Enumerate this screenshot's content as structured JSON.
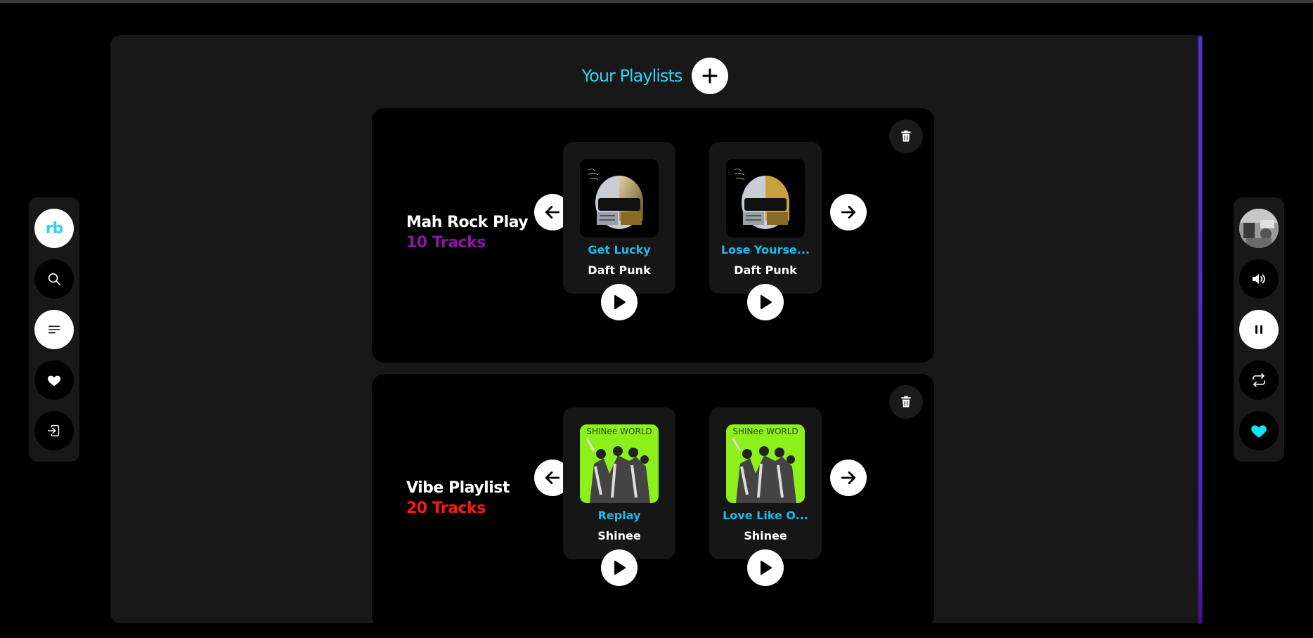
{
  "header": {
    "title": "Your Playlists"
  },
  "app": {
    "logo_text": "rb"
  },
  "colors": {
    "accent": "#2fd3f1",
    "track_title": "#1ebbe8",
    "count_purple": "#8b16a6",
    "count_red": "#ff1616",
    "scroll_thumb": "#5b2de6"
  },
  "left_nav": [
    {
      "name": "logo",
      "icon": "rb-logo"
    },
    {
      "name": "search",
      "icon": "search-icon"
    },
    {
      "name": "playlists",
      "icon": "list-icon"
    },
    {
      "name": "liked",
      "icon": "heart-icon"
    },
    {
      "name": "logout",
      "icon": "logout-icon"
    }
  ],
  "right_controls": [
    {
      "name": "user-avatar",
      "icon": "avatar"
    },
    {
      "name": "volume",
      "icon": "volume-icon"
    },
    {
      "name": "pause",
      "icon": "pause-icon"
    },
    {
      "name": "repeat",
      "icon": "repeat-icon"
    },
    {
      "name": "like",
      "icon": "heart-icon"
    }
  ],
  "playlists": [
    {
      "name": "Mah Rock Play",
      "count": "10 Tracks",
      "count_color": "#8b16a6",
      "tracks": [
        {
          "title": "Get Lucky",
          "artist": "Daft Punk",
          "cover": "daft-punk-helmets"
        },
        {
          "title": "Lose Yourse...",
          "artist": "Daft Punk",
          "cover": "daft-punk-helmets"
        }
      ]
    },
    {
      "name": "Vibe Playlist",
      "count": "20 Tracks",
      "count_color": "#ff1616",
      "tracks": [
        {
          "title": "Replay",
          "artist": "Shinee",
          "cover": "shinee-world"
        },
        {
          "title": "Love Like O...",
          "artist": "Shinee",
          "cover": "shinee-world"
        }
      ]
    }
  ],
  "cover_text": {
    "shinee": "SHINee WORLD"
  }
}
